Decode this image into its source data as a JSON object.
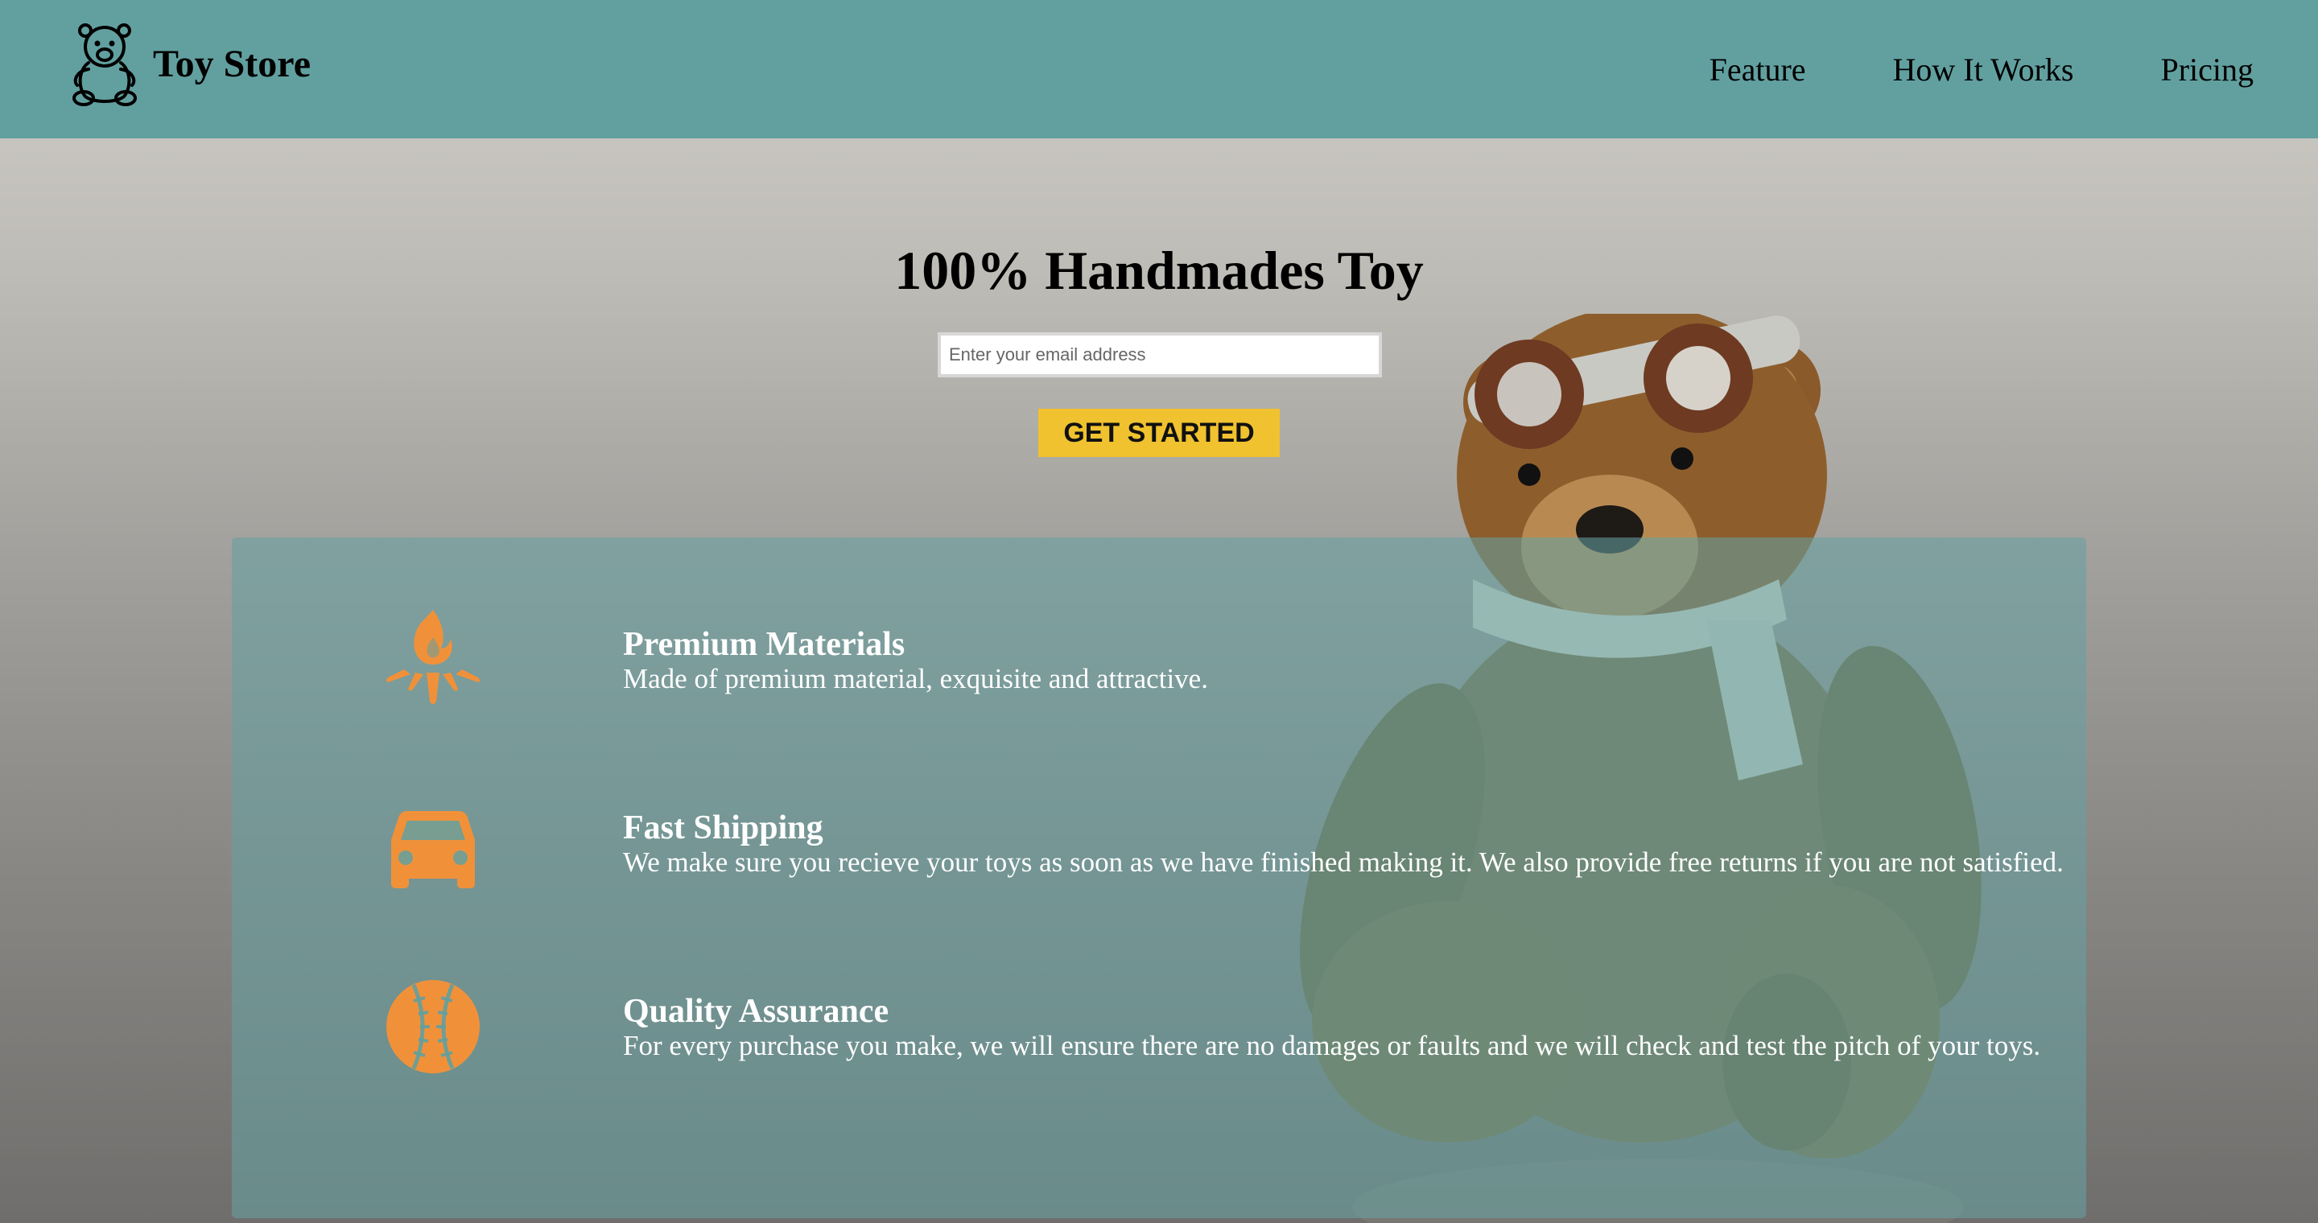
{
  "brand": {
    "name": "Toy Store",
    "logo_icon": "teddy-bear-icon"
  },
  "nav": {
    "items": [
      {
        "label": "Feature"
      },
      {
        "label": "How It Works"
      },
      {
        "label": "Pricing"
      }
    ]
  },
  "hero": {
    "title": "100% Handmades Toy",
    "email_placeholder": "Enter your email address",
    "cta_label": "GET STARTED"
  },
  "features": [
    {
      "icon": "fire-icon",
      "title": "Premium Materials",
      "description": "Made of premium material, exquisite and attractive."
    },
    {
      "icon": "car-icon",
      "title": "Fast Shipping",
      "description": "We make sure you recieve your toys as soon as we have finished making it. We also provide free returns if you are not satisfied."
    },
    {
      "icon": "baseball-icon",
      "title": "Quality Assurance",
      "description": "For every purchase you make, we will ensure there are no damages or faults and we will check and test the pitch of your toys."
    }
  ],
  "colors": {
    "header_bg": "#62a0a0",
    "accent": "#f0c22f",
    "icon_orange": "#f0913a",
    "panel_overlay": "#66a0a0"
  }
}
